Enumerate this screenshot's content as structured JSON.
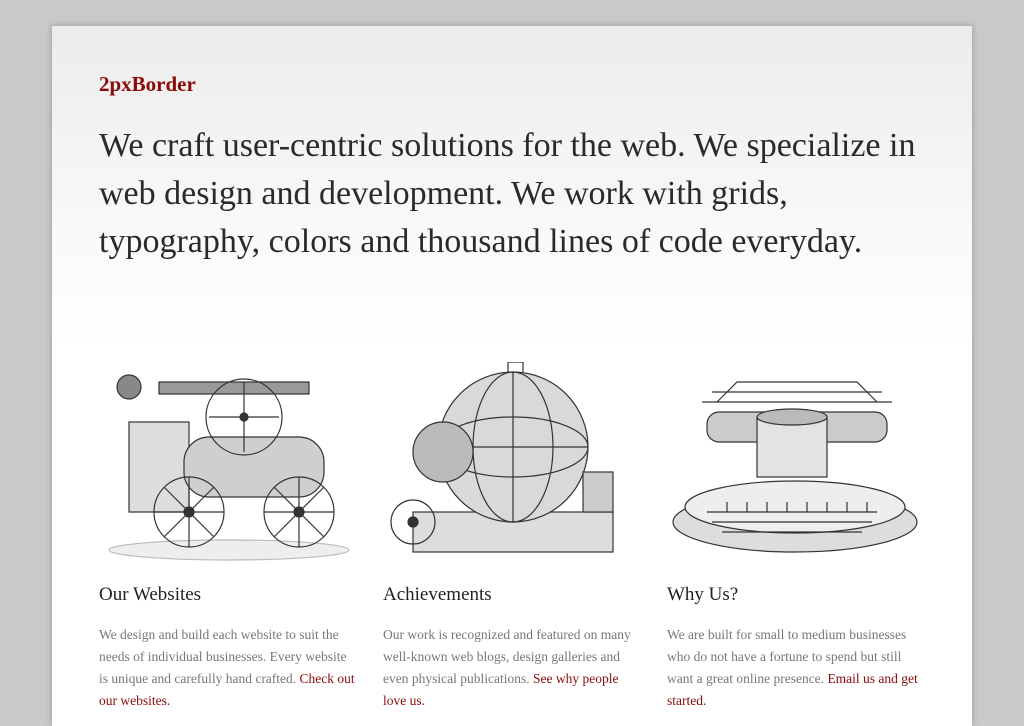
{
  "brand": {
    "name": "2pxBorder"
  },
  "hero": {
    "text": "We craft user-centric solutions for the web. We specialize in web design and development. We work with grids, typography, colors and thousand lines of code everyday."
  },
  "columns": [
    {
      "illustration_icon": "steam-engine-engraving-icon",
      "title": "Our Websites",
      "text": "We design and build each website to suit the needs of individual businesses. Every website is unique and carefully hand crafted.",
      "link": "Check out our websites."
    },
    {
      "illustration_icon": "boiler-sphere-engraving-icon",
      "title": "Achievements",
      "text": "Our work is recognized and featured on many well-known web blogs, design galleries and even physical publications.",
      "link": "See why people love us."
    },
    {
      "illustration_icon": "typewriter-engraving-icon",
      "title": "Why Us?",
      "text": "We are built for small to medium businesses who do not have a fortune to spend but still want a great online presence.",
      "link": "Email us and get started."
    }
  ],
  "colors": {
    "brand": "#8b0a0a",
    "background": "#c9c9c9",
    "page": "#ffffff"
  }
}
